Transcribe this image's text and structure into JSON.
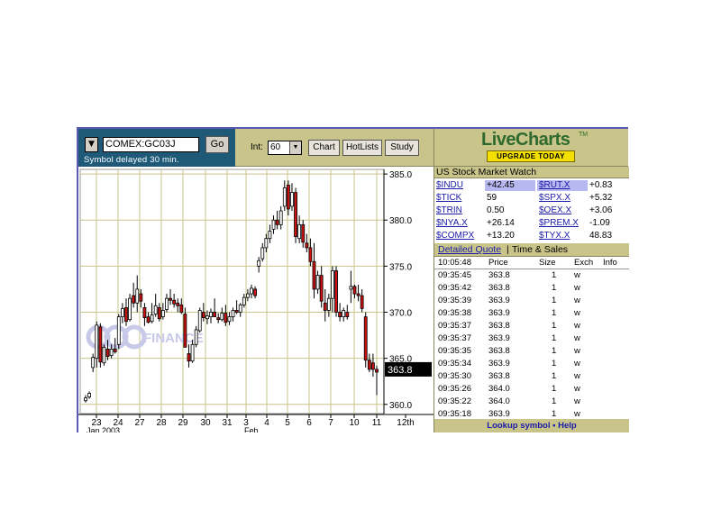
{
  "toolbar": {
    "symbol_value": "COMEX:GC03J",
    "go_label": "Go",
    "delay_text": "Symbol delayed 30 min.",
    "interval_label": "Int:",
    "interval_value": "60",
    "buttons": [
      "Chart",
      "HotLists",
      "Study"
    ]
  },
  "logo": {
    "title": "LiveCharts",
    "tm": "TM",
    "upgrade_label": "UPGRADE TODAY"
  },
  "watermark": "FINANCE",
  "chart_data": {
    "type": "candlestick",
    "title": "",
    "xlabel": "",
    "ylabel": "",
    "ylim": [
      359.0,
      385.5
    ],
    "yticks": [
      "385.0",
      "380.0",
      "375.0",
      "370.0",
      "365.0",
      "360.0"
    ],
    "ytick_values": [
      385,
      380,
      375,
      370,
      365,
      360
    ],
    "xticks": [
      "23",
      "24",
      "27",
      "28",
      "29",
      "30",
      "31",
      "3",
      "4",
      "5",
      "6",
      "7",
      "10",
      "11",
      "12th"
    ],
    "x_sublabels": {
      "23": "Jan 2003",
      "3": "Feb"
    },
    "last_price": "363.8",
    "candles": [
      [
        360.4,
        361.0,
        360.2,
        360.7
      ],
      [
        360.8,
        361.4,
        360.6,
        361.2
      ],
      [
        364.0,
        365.5,
        363.5,
        365.1
      ],
      [
        365.0,
        369.0,
        364.0,
        368.6
      ],
      [
        368.4,
        368.8,
        364.0,
        364.6
      ],
      [
        364.5,
        366.5,
        364.2,
        366.2
      ],
      [
        366.0,
        367.0,
        364.8,
        365.2
      ],
      [
        365.3,
        366.5,
        365.0,
        366.0
      ],
      [
        366.0,
        367.2,
        365.5,
        365.7
      ],
      [
        366.5,
        369.8,
        366.0,
        369.5
      ],
      [
        369.5,
        371.0,
        368.8,
        370.4
      ],
      [
        370.5,
        371.5,
        368.5,
        369.0
      ],
      [
        369.2,
        372.0,
        369.0,
        371.5
      ],
      [
        371.8,
        373.2,
        370.5,
        371.0
      ],
      [
        371.0,
        374.0,
        370.0,
        372.5
      ],
      [
        372.0,
        372.5,
        370.5,
        371.2
      ],
      [
        370.5,
        371.0,
        368.5,
        369.4
      ],
      [
        369.5,
        370.0,
        368.8,
        368.9
      ],
      [
        369.0,
        371.0,
        368.8,
        369.7
      ],
      [
        369.8,
        372.0,
        369.5,
        370.7
      ],
      [
        370.5,
        371.0,
        369.0,
        369.3
      ],
      [
        369.5,
        371.0,
        369.2,
        370.2
      ],
      [
        370.3,
        372.0,
        370.0,
        371.5
      ],
      [
        371.5,
        372.5,
        370.8,
        371.3
      ],
      [
        371.3,
        372.0,
        370.5,
        370.9
      ],
      [
        371.0,
        371.5,
        370.0,
        370.7
      ],
      [
        370.8,
        371.5,
        369.8,
        370.0
      ],
      [
        369.8,
        370.5,
        367.5,
        366.2
      ],
      [
        365.5,
        366.5,
        364.0,
        364.7
      ],
      [
        364.7,
        367.0,
        364.5,
        366.5
      ],
      [
        366.5,
        368.5,
        366.2,
        368.1
      ],
      [
        368.0,
        370.5,
        367.8,
        370.2
      ],
      [
        370.0,
        371.0,
        369.0,
        369.4
      ],
      [
        369.3,
        370.2,
        368.7,
        369.6
      ],
      [
        369.5,
        370.4,
        368.8,
        370.0
      ],
      [
        370.0,
        371.5,
        369.7,
        369.5
      ],
      [
        369.4,
        369.9,
        368.8,
        369.2
      ],
      [
        369.2,
        370.5,
        369.0,
        369.9
      ],
      [
        369.9,
        370.8,
        368.5,
        368.9
      ],
      [
        369.0,
        370.0,
        368.6,
        369.5
      ],
      [
        369.5,
        370.5,
        369.0,
        370.2
      ],
      [
        370.2,
        371.3,
        369.8,
        370.0
      ],
      [
        370.0,
        371.0,
        369.5,
        370.8
      ],
      [
        370.8,
        372.0,
        370.5,
        371.6
      ],
      [
        371.6,
        372.5,
        371.2,
        372.0
      ],
      [
        372.0,
        373.0,
        371.5,
        372.6
      ],
      [
        372.5,
        372.8,
        371.5,
        371.8
      ],
      [
        375.0,
        376.0,
        374.3,
        375.6
      ],
      [
        375.8,
        377.5,
        375.5,
        377.0
      ],
      [
        377.0,
        378.5,
        376.5,
        378.0
      ],
      [
        378.0,
        379.5,
        377.5,
        378.8
      ],
      [
        379.0,
        380.5,
        378.5,
        380.0
      ],
      [
        380.0,
        381.0,
        379.0,
        379.5
      ],
      [
        379.5,
        381.5,
        379.0,
        381.0
      ],
      [
        381.5,
        384.3,
        381.0,
        383.5
      ],
      [
        383.8,
        384.3,
        380.5,
        381.2
      ],
      [
        381.5,
        384.0,
        381.0,
        383.0
      ],
      [
        383.0,
        383.5,
        377.5,
        378.2
      ],
      [
        378.0,
        380.5,
        377.5,
        379.5
      ],
      [
        379.5,
        380.0,
        377.0,
        377.6
      ],
      [
        377.5,
        378.5,
        376.5,
        377.0
      ],
      [
        377.0,
        378.0,
        375.0,
        375.5
      ],
      [
        375.5,
        377.5,
        371.5,
        372.5
      ],
      [
        372.5,
        374.5,
        372.0,
        374.0
      ],
      [
        374.0,
        375.0,
        370.5,
        371.2
      ],
      [
        371.0,
        372.5,
        369.0,
        370.2
      ],
      [
        370.2,
        372.0,
        369.5,
        371.5
      ],
      [
        371.5,
        375.0,
        370.0,
        374.5
      ],
      [
        374.5,
        375.0,
        369.5,
        370.0
      ],
      [
        370.0,
        371.0,
        369.0,
        369.5
      ],
      [
        369.5,
        370.5,
        369.0,
        370.2
      ],
      [
        370.0,
        370.8,
        369.2,
        369.5
      ],
      [
        372.5,
        374.5,
        371.0,
        372.8
      ],
      [
        372.8,
        373.0,
        371.5,
        372.0
      ],
      [
        372.0,
        373.0,
        371.2,
        371.8
      ],
      [
        371.8,
        372.5,
        370.0,
        370.4
      ],
      [
        369.5,
        370.0,
        364.0,
        364.8
      ],
      [
        364.8,
        365.5,
        363.5,
        363.8
      ],
      [
        364.5,
        365.5,
        363.0,
        363.8
      ],
      [
        363.8,
        364.2,
        361.0,
        363.5
      ]
    ]
  },
  "market_watch": {
    "title": "US Stock Market Watch",
    "rows": [
      {
        "sym1": "$INDU",
        "val1": "+42.45",
        "sym2": "$RUT.X",
        "val2": "+0.83"
      },
      {
        "sym1": "$TICK",
        "val1": "59",
        "sym2": "$SPX.X",
        "val2": "+5.32"
      },
      {
        "sym1": "$TRIN",
        "val1": "0.50",
        "sym2": "$OEX.X",
        "val2": "+3.06"
      },
      {
        "sym1": "$NYA.X",
        "val1": "+26.14",
        "sym2": "$PREM.X",
        "val2": "-1.09"
      },
      {
        "sym1": "$COMPX",
        "val1": "+13.20",
        "sym2": "$TYX.X",
        "val2": "48.83"
      }
    ],
    "highlight_color": "#b8b8f0"
  },
  "time_sales": {
    "tab_detailed": "Detailed Quote",
    "tab_sep": "|",
    "tab_ts": "Time & Sales",
    "header": {
      "time": "10:05:48",
      "price": "Price",
      "size": "Size",
      "exch": "Exch",
      "info": "Info"
    },
    "rows": [
      {
        "time": "09:35:45",
        "price": "363.8",
        "size": "1",
        "exch": "w"
      },
      {
        "time": "09:35:42",
        "price": "363.8",
        "size": "1",
        "exch": "w"
      },
      {
        "time": "09:35:39",
        "price": "363.9",
        "size": "1",
        "exch": "w"
      },
      {
        "time": "09:35:38",
        "price": "363.9",
        "size": "1",
        "exch": "w"
      },
      {
        "time": "09:35:37",
        "price": "363.8",
        "size": "1",
        "exch": "w"
      },
      {
        "time": "09:35:37",
        "price": "363.9",
        "size": "1",
        "exch": "w"
      },
      {
        "time": "09:35:35",
        "price": "363.8",
        "size": "1",
        "exch": "w"
      },
      {
        "time": "09:35:34",
        "price": "363.9",
        "size": "1",
        "exch": "w"
      },
      {
        "time": "09:35:30",
        "price": "363.8",
        "size": "1",
        "exch": "w"
      },
      {
        "time": "09:35:26",
        "price": "364.0",
        "size": "1",
        "exch": "w"
      },
      {
        "time": "09:35:22",
        "price": "364.0",
        "size": "1",
        "exch": "w"
      },
      {
        "time": "09:35:18",
        "price": "363.9",
        "size": "1",
        "exch": "w"
      }
    ]
  },
  "footer": {
    "lookup": "Lookup symbol",
    "sep": "▪",
    "help": "Help"
  },
  "colors": {
    "up": "#ffffff",
    "down": "#cc1111",
    "panel": "#c8c48a",
    "sym_bg": "#1e5a78"
  }
}
